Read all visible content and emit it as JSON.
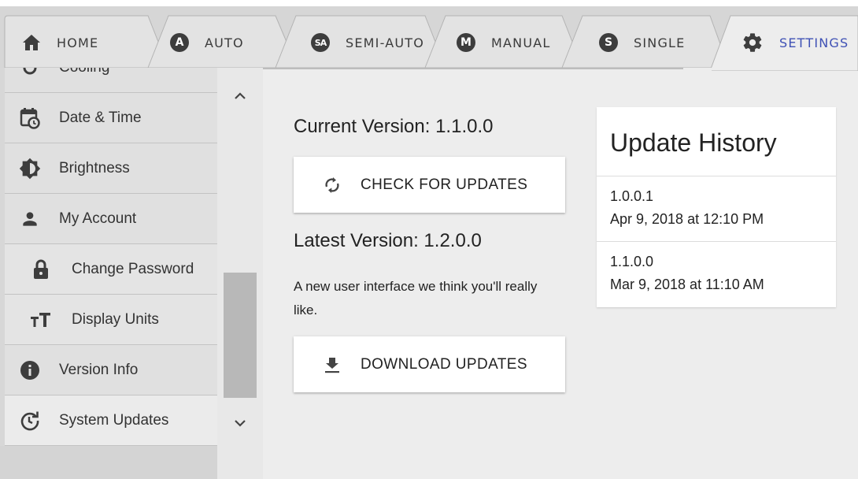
{
  "tabs": [
    {
      "id": "home",
      "label": "HOME",
      "icon": "home-icon",
      "active": false
    },
    {
      "id": "auto",
      "label": "AUTO",
      "badge": "A",
      "active": false
    },
    {
      "id": "semi_auto",
      "label": "SEMI-AUTO",
      "badge": "SA",
      "active": false
    },
    {
      "id": "manual",
      "label": "MANUAL",
      "badge": "M",
      "active": false
    },
    {
      "id": "single",
      "label": "SINGLE",
      "badge": "S",
      "active": false
    },
    {
      "id": "settings",
      "label": "SETTINGS",
      "icon": "gear-icon",
      "active": true
    }
  ],
  "sidebar": {
    "items": [
      {
        "label": "Cooling",
        "icon": "cooling-icon"
      },
      {
        "label": "Date & Time",
        "icon": "calendar-clock-icon"
      },
      {
        "label": "Brightness",
        "icon": "brightness-icon"
      },
      {
        "label": "My Account",
        "icon": "person-icon"
      },
      {
        "label": "Change Password",
        "icon": "lock-icon",
        "sub": true
      },
      {
        "label": "Display Units",
        "icon": "text-size-icon",
        "sub": true
      },
      {
        "label": "Version Info",
        "icon": "info-icon"
      },
      {
        "label": "System Updates",
        "icon": "update-history-icon",
        "selected": true
      }
    ]
  },
  "main": {
    "current_version": "Current Version: 1.1.0.0",
    "check_button": "CHECK FOR UPDATES",
    "latest_version": "Latest Version: 1.2.0.0",
    "description": "A new user interface we think you'll really like.",
    "download_button": "DOWNLOAD UPDATES"
  },
  "history": {
    "title": "Update History",
    "entries": [
      {
        "version": "1.0.0.1",
        "date": "Apr 9, 2018 at 12:10 PM"
      },
      {
        "version": "1.1.0.0",
        "date": "Mar 9, 2018 at 11:10 AM"
      }
    ]
  },
  "colors": {
    "accent": "#3f51b5",
    "icon_dark": "#3d3d3d",
    "sidebar_bg": "#d7d7d7",
    "main_bg": "#ededed"
  }
}
